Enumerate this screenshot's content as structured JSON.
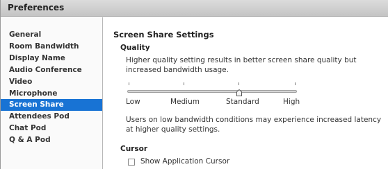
{
  "window": {
    "title": "Preferences"
  },
  "sidebar": {
    "items": [
      {
        "label": "General"
      },
      {
        "label": "Room Bandwidth"
      },
      {
        "label": "Display Name"
      },
      {
        "label": "Audio Conference"
      },
      {
        "label": "Video"
      },
      {
        "label": "Microphone"
      },
      {
        "label": "Screen Share",
        "active": true
      },
      {
        "label": "Attendees Pod"
      },
      {
        "label": "Chat Pod"
      },
      {
        "label": "Q & A Pod"
      }
    ]
  },
  "main": {
    "title": "Screen Share Settings",
    "quality": {
      "heading": "Quality",
      "description": "Higher quality setting results in better screen share quality but increased bandwidth usage.",
      "levels": [
        "Low",
        "Medium",
        "Standard",
        "High"
      ],
      "selected": "Standard",
      "note": "Users on low bandwidth conditions may experience increased latency at higher quality settings."
    },
    "cursor": {
      "heading": "Cursor",
      "checkbox_label": "Show Application Cursor",
      "checked": false
    }
  },
  "colors": {
    "selection": "#1873d4",
    "titlebar": "#cfcfcf"
  }
}
